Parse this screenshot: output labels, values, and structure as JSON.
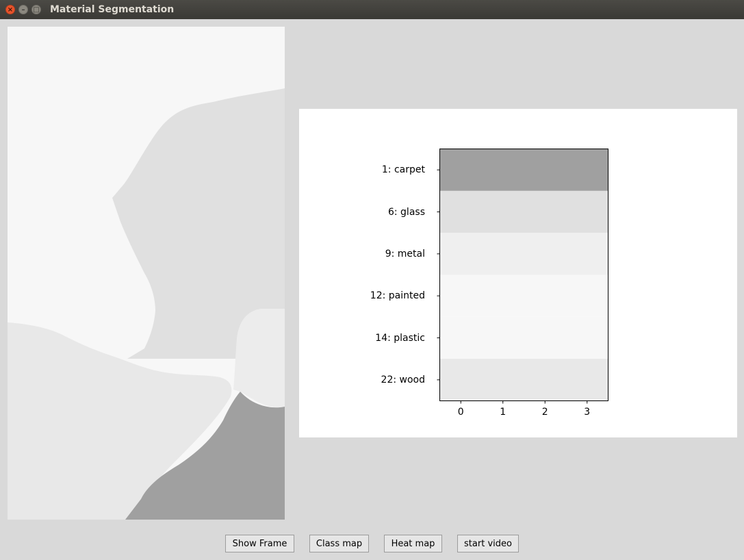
{
  "window": {
    "title": "Material Segmentation",
    "close_glyph": "×",
    "min_glyph": "–",
    "max_glyph": "□"
  },
  "chart_data": {
    "type": "heatmap",
    "rows": [
      "1: carpet",
      "6: glass",
      "9: metal",
      "12: painted",
      "14: plastic",
      "22: wood"
    ],
    "columns": [
      "0",
      "1",
      "2",
      "3"
    ],
    "row_shades": [
      "#a0a0a0",
      "#e0e0e0",
      "#efefef",
      "#f7f7f7",
      "#f7f7f7",
      "#e8e8e8"
    ]
  },
  "buttons": {
    "show_frame": "Show Frame",
    "class_map": "Class map",
    "heat_map": "Heat map",
    "start_video": "start video"
  }
}
